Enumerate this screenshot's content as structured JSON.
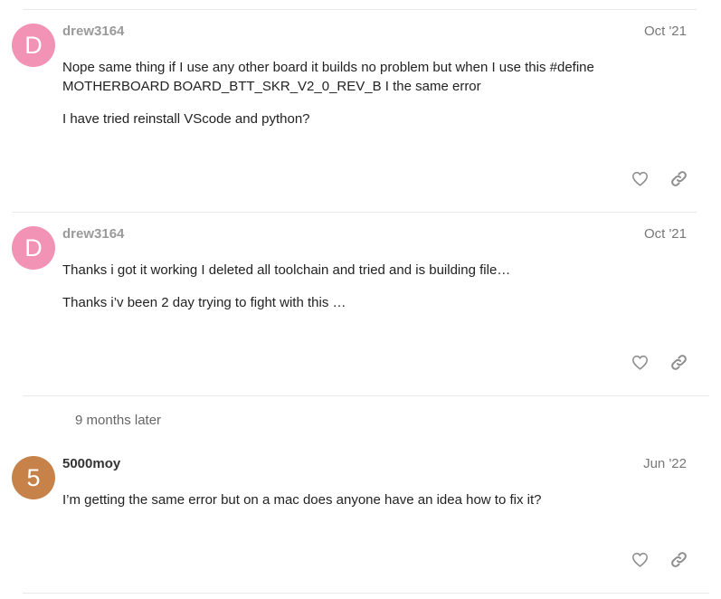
{
  "colors": {
    "avatar_pink": "#f292b5",
    "avatar_orange": "#c78249",
    "divider": "#e9e9e9",
    "icon_gray": "#8f8f8f"
  },
  "posts": [
    {
      "avatar_letter": "D",
      "username": "drew3164",
      "date": "Oct '21",
      "paragraphs": [
        "Nope same thing if I use any other board it builds no problem but when I use this #define MOTHERBOARD BOARD_BTT_SKR_V2_0_REV_B I the same error",
        "I have tried reinstall VScode and python?"
      ],
      "like_icon": "heart-icon",
      "share_icon": "link-icon"
    },
    {
      "avatar_letter": "D",
      "username": "drew3164",
      "date": "Oct '21",
      "paragraphs": [
        "Thanks i got it working I deleted all toolchain and tried and is building file…",
        "Thanks i’v been 2 day trying to fight with this …"
      ],
      "like_icon": "heart-icon",
      "share_icon": "link-icon"
    },
    {
      "avatar_letter": "5",
      "username": "5000moy",
      "date": "Jun '22",
      "paragraphs": [
        "I’m getting the same error but on a mac does anyone have an idea how to fix it?"
      ],
      "like_icon": "heart-icon",
      "share_icon": "link-icon"
    }
  ],
  "time_gap": "9 months later"
}
